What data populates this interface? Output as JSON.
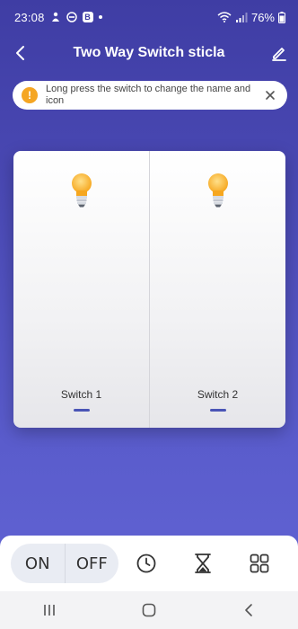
{
  "status_bar": {
    "time": "23:08",
    "battery_percent": "76%"
  },
  "header": {
    "title": "Two Way Switch sticla"
  },
  "tip": {
    "icon_symbol": "!",
    "text": "Long press the switch to change the name and icon"
  },
  "switches": [
    {
      "label": "Switch 1",
      "icon": "lightbulb-icon"
    },
    {
      "label": "Switch 2",
      "icon": "lightbulb-icon"
    }
  ],
  "controls": {
    "on_label": "ON",
    "off_label": "OFF",
    "icons": [
      "clock-icon",
      "hourglass-icon",
      "grid-icon"
    ]
  },
  "colors": {
    "background": "#4a49b4",
    "accent": "#4a55b6",
    "bulb": "#f9b233",
    "warning": "#f5a623"
  }
}
